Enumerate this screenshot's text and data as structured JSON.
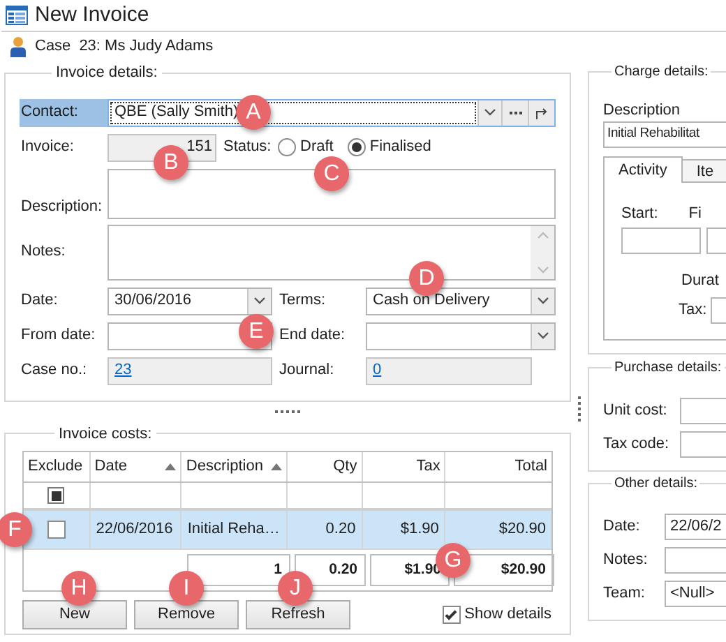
{
  "window": {
    "title": "New Invoice"
  },
  "case": {
    "label": "Case",
    "value": "23: Ms Judy Adams"
  },
  "invoice_details": {
    "title": "Invoice details:",
    "contact": {
      "label": "Contact:",
      "value": "QBE (Sally Smith)",
      "focused": true
    },
    "invoice": {
      "label": "Invoice:",
      "value": "151"
    },
    "status": {
      "label": "Status:",
      "options": [
        {
          "label": "Draft",
          "selected": false
        },
        {
          "label": "Finalised",
          "selected": true
        }
      ]
    },
    "description": {
      "label": "Description:"
    },
    "notes": {
      "label": "Notes:"
    },
    "date": {
      "label": "Date:",
      "value": "30/06/2016"
    },
    "terms": {
      "label": "Terms:",
      "value": "Cash on Delivery"
    },
    "from_date": {
      "label": "From date:"
    },
    "end_date": {
      "label": "End date:"
    },
    "case_no": {
      "label": "Case no.:",
      "value": "23"
    },
    "journal": {
      "label": "Journal:",
      "value": "0"
    }
  },
  "invoice_costs": {
    "title": "Invoice costs:",
    "columns": [
      {
        "label": "Exclude",
        "sorted": false
      },
      {
        "label": "Date",
        "sorted": true
      },
      {
        "label": "Description",
        "sorted": true
      },
      {
        "label": "Qty",
        "sorted": false
      },
      {
        "label": "Tax",
        "sorted": false
      },
      {
        "label": "Total",
        "sorted": false
      }
    ],
    "filter_exclude_partial": true,
    "rows": [
      {
        "exclude": false,
        "selected": true,
        "cells": [
          "",
          "22/06/2016",
          "Initial Reha…",
          "0.20",
          "$1.90",
          "$20.90"
        ]
      }
    ],
    "totals": [
      "1",
      "0.20",
      "$1.90",
      "$20.90"
    ],
    "buttons": [
      "New",
      "Remove",
      "Refresh"
    ],
    "show_details": {
      "label": "Show details",
      "checked": true
    }
  },
  "charge_details": {
    "title": "Charge details:",
    "description_label": "Description",
    "description_value": "Initial Rehabilitat",
    "tabs": [
      {
        "label": "Activity",
        "selected": true
      },
      {
        "label": "Ite",
        "selected": false
      }
    ],
    "start_label": "Start:",
    "finish_label": "Fi",
    "duration_label": "Durat",
    "tax_label": "Tax:"
  },
  "purchase_details": {
    "title": "Purchase details:",
    "fields": [
      {
        "label": "Unit cost:"
      },
      {
        "label": "Tax code:"
      }
    ]
  },
  "other_details": {
    "title": "Other details:",
    "fields": [
      {
        "label": "Date:",
        "value": "22/06/2"
      },
      {
        "label": "Notes:"
      },
      {
        "label": "Team:",
        "value": "<Null>"
      }
    ]
  },
  "callouts": [
    "A",
    "B",
    "C",
    "D",
    "E",
    "F",
    "G",
    "H",
    "I",
    "J"
  ]
}
